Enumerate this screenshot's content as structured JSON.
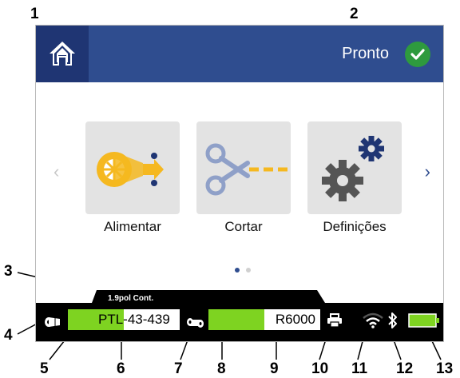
{
  "callouts": [
    "1",
    "2",
    "3",
    "4",
    "5",
    "6",
    "7",
    "8",
    "9",
    "10",
    "11",
    "12",
    "13"
  ],
  "header": {
    "status": "Pronto",
    "status_color": "#2e9a3e",
    "bar_color": "#2f4d8f"
  },
  "tiles": [
    {
      "label": "Alimentar",
      "icon": "feed-icon"
    },
    {
      "label": "Cortar",
      "icon": "scissors-icon"
    },
    {
      "label": "Definições",
      "icon": "settings-gears-icon"
    }
  ],
  "pager": {
    "pages": 2,
    "active": 1
  },
  "status_bar": {
    "media_info": "1.9pol Cont.",
    "label_part": "PTL-43-439",
    "label_fill": 0.5,
    "ribbon_part": "R6000",
    "ribbon_fill": 0.5,
    "fill_color": "#7ed321"
  }
}
